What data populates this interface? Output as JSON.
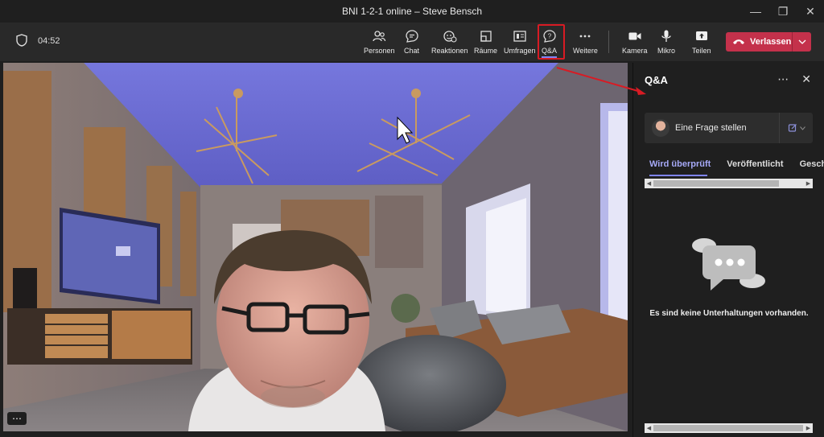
{
  "window": {
    "title": "BNI 1-2-1 online – Steve Bensch",
    "controls": [
      "minimize",
      "maximize",
      "close"
    ]
  },
  "call": {
    "timer": "04:52"
  },
  "toolbar": {
    "buttons": [
      {
        "label": "Personen",
        "icon": "people-icon"
      },
      {
        "label": "Chat",
        "icon": "chat-icon"
      },
      {
        "label": "Reaktionen",
        "icon": "reactions-icon"
      },
      {
        "label": "Räume",
        "icon": "rooms-icon"
      },
      {
        "label": "Umfragen",
        "icon": "polls-icon"
      },
      {
        "label": "Q&A",
        "icon": "qa-icon",
        "active": true
      },
      {
        "label": "Weitere",
        "icon": "more-icon"
      },
      {
        "label": "Kamera",
        "icon": "camera-icon"
      },
      {
        "label": "Mikro",
        "icon": "mic-icon"
      },
      {
        "label": "Teilen",
        "icon": "share-icon"
      }
    ],
    "leave_label": "Verlassen"
  },
  "panel": {
    "title": "Q&A",
    "ask_label": "Eine Frage stellen",
    "tabs": [
      "Wird überprüft",
      "Veröffentlicht",
      "Gesch"
    ],
    "empty_message": "Es sind keine Unterhaltungen vorhanden."
  },
  "colors": {
    "accent": "#7f85f5",
    "leave": "#c4314b",
    "highlight": "#d81b24"
  }
}
